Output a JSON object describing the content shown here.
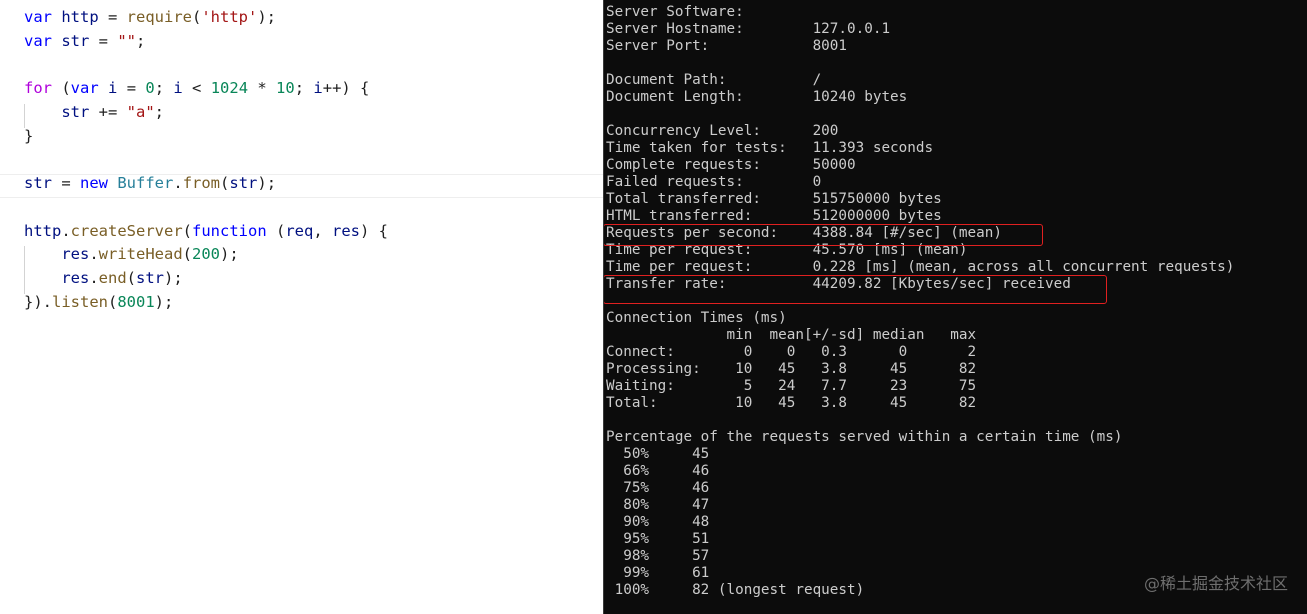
{
  "editor": {
    "lines": [
      {
        "tokens": [
          {
            "t": "var",
            "c": "kw"
          },
          {
            "t": " ",
            "c": "pun"
          },
          {
            "t": "http",
            "c": "id"
          },
          {
            "t": " = ",
            "c": "pun"
          },
          {
            "t": "require",
            "c": "fn"
          },
          {
            "t": "(",
            "c": "pun"
          },
          {
            "t": "'http'",
            "c": "str"
          },
          {
            "t": ");",
            "c": "pun"
          }
        ]
      },
      {
        "tokens": [
          {
            "t": "var",
            "c": "kw"
          },
          {
            "t": " ",
            "c": "pun"
          },
          {
            "t": "str",
            "c": "id"
          },
          {
            "t": " = ",
            "c": "pun"
          },
          {
            "t": "\"\"",
            "c": "str"
          },
          {
            "t": ";",
            "c": "pun"
          }
        ]
      },
      {
        "tokens": []
      },
      {
        "tokens": [
          {
            "t": "for",
            "c": "kw2"
          },
          {
            "t": " (",
            "c": "pun"
          },
          {
            "t": "var",
            "c": "kw"
          },
          {
            "t": " ",
            "c": "pun"
          },
          {
            "t": "i",
            "c": "id"
          },
          {
            "t": " = ",
            "c": "pun"
          },
          {
            "t": "0",
            "c": "num"
          },
          {
            "t": "; ",
            "c": "pun"
          },
          {
            "t": "i",
            "c": "id"
          },
          {
            "t": " < ",
            "c": "pun"
          },
          {
            "t": "1024",
            "c": "num"
          },
          {
            "t": " * ",
            "c": "pun"
          },
          {
            "t": "10",
            "c": "num"
          },
          {
            "t": "; ",
            "c": "pun"
          },
          {
            "t": "i",
            "c": "id"
          },
          {
            "t": "++) {",
            "c": "pun"
          }
        ]
      },
      {
        "tokens": [
          {
            "t": "    ",
            "c": "pun"
          },
          {
            "t": "str",
            "c": "id"
          },
          {
            "t": " += ",
            "c": "pun"
          },
          {
            "t": "\"a\"",
            "c": "str"
          },
          {
            "t": ";",
            "c": "pun"
          }
        ]
      },
      {
        "tokens": [
          {
            "t": "}",
            "c": "pun"
          }
        ]
      },
      {
        "tokens": []
      },
      {
        "tokens": [
          {
            "t": "str",
            "c": "id"
          },
          {
            "t": " = ",
            "c": "pun"
          },
          {
            "t": "new",
            "c": "kw"
          },
          {
            "t": " ",
            "c": "pun"
          },
          {
            "t": "Buffer",
            "c": "cls"
          },
          {
            "t": ".",
            "c": "pun"
          },
          {
            "t": "from",
            "c": "fn"
          },
          {
            "t": "(",
            "c": "pun"
          },
          {
            "t": "str",
            "c": "id"
          },
          {
            "t": ");",
            "c": "pun"
          }
        ]
      },
      {
        "tokens": []
      },
      {
        "tokens": [
          {
            "t": "http",
            "c": "id"
          },
          {
            "t": ".",
            "c": "pun"
          },
          {
            "t": "createServer",
            "c": "fn"
          },
          {
            "t": "(",
            "c": "pun"
          },
          {
            "t": "function",
            "c": "kw"
          },
          {
            "t": " (",
            "c": "pun"
          },
          {
            "t": "req",
            "c": "id"
          },
          {
            "t": ", ",
            "c": "pun"
          },
          {
            "t": "res",
            "c": "id"
          },
          {
            "t": ") {",
            "c": "pun"
          }
        ]
      },
      {
        "tokens": [
          {
            "t": "    ",
            "c": "pun"
          },
          {
            "t": "res",
            "c": "id"
          },
          {
            "t": ".",
            "c": "pun"
          },
          {
            "t": "writeHead",
            "c": "fn"
          },
          {
            "t": "(",
            "c": "pun"
          },
          {
            "t": "200",
            "c": "num"
          },
          {
            "t": ");",
            "c": "pun"
          }
        ]
      },
      {
        "tokens": [
          {
            "t": "    ",
            "c": "pun"
          },
          {
            "t": "res",
            "c": "id"
          },
          {
            "t": ".",
            "c": "pun"
          },
          {
            "t": "end",
            "c": "fn"
          },
          {
            "t": "(",
            "c": "pun"
          },
          {
            "t": "str",
            "c": "id"
          },
          {
            "t": ");",
            "c": "pun"
          }
        ]
      },
      {
        "tokens": [
          {
            "t": "}).",
            "c": "pun"
          },
          {
            "t": "listen",
            "c": "fn"
          },
          {
            "t": "(",
            "c": "pun"
          },
          {
            "t": "8001",
            "c": "num"
          },
          {
            "t": ");",
            "c": "pun"
          }
        ]
      }
    ]
  },
  "terminal": {
    "lines": [
      "Server Software:",
      "Server Hostname:        127.0.0.1",
      "Server Port:            8001",
      "",
      "Document Path:          /",
      "Document Length:        10240 bytes",
      "",
      "Concurrency Level:      200",
      "Time taken for tests:   11.393 seconds",
      "Complete requests:      50000",
      "Failed requests:        0",
      "Total transferred:      515750000 bytes",
      "HTML transferred:       512000000 bytes",
      "Requests per second:    4388.84 [#/sec] (mean)",
      "Time per request:       45.570 [ms] (mean)",
      "Time per request:       0.228 [ms] (mean, across all concurrent requests)",
      "Transfer rate:          44209.82 [Kbytes/sec] received",
      "",
      "Connection Times (ms)",
      "              min  mean[+/-sd] median   max",
      "Connect:        0    0   0.3      0       2",
      "Processing:    10   45   3.8     45      82",
      "Waiting:        5   24   7.7     23      75",
      "Total:         10   45   3.8     45      82",
      "",
      "Percentage of the requests served within a certain time (ms)",
      "  50%     45",
      "  66%     46",
      "  75%     46",
      "  80%     47",
      "  90%     48",
      "  95%     51",
      "  98%     57",
      "  99%     61",
      " 100%     82 (longest request)"
    ]
  },
  "watermark": "@稀土掘金技术社区"
}
